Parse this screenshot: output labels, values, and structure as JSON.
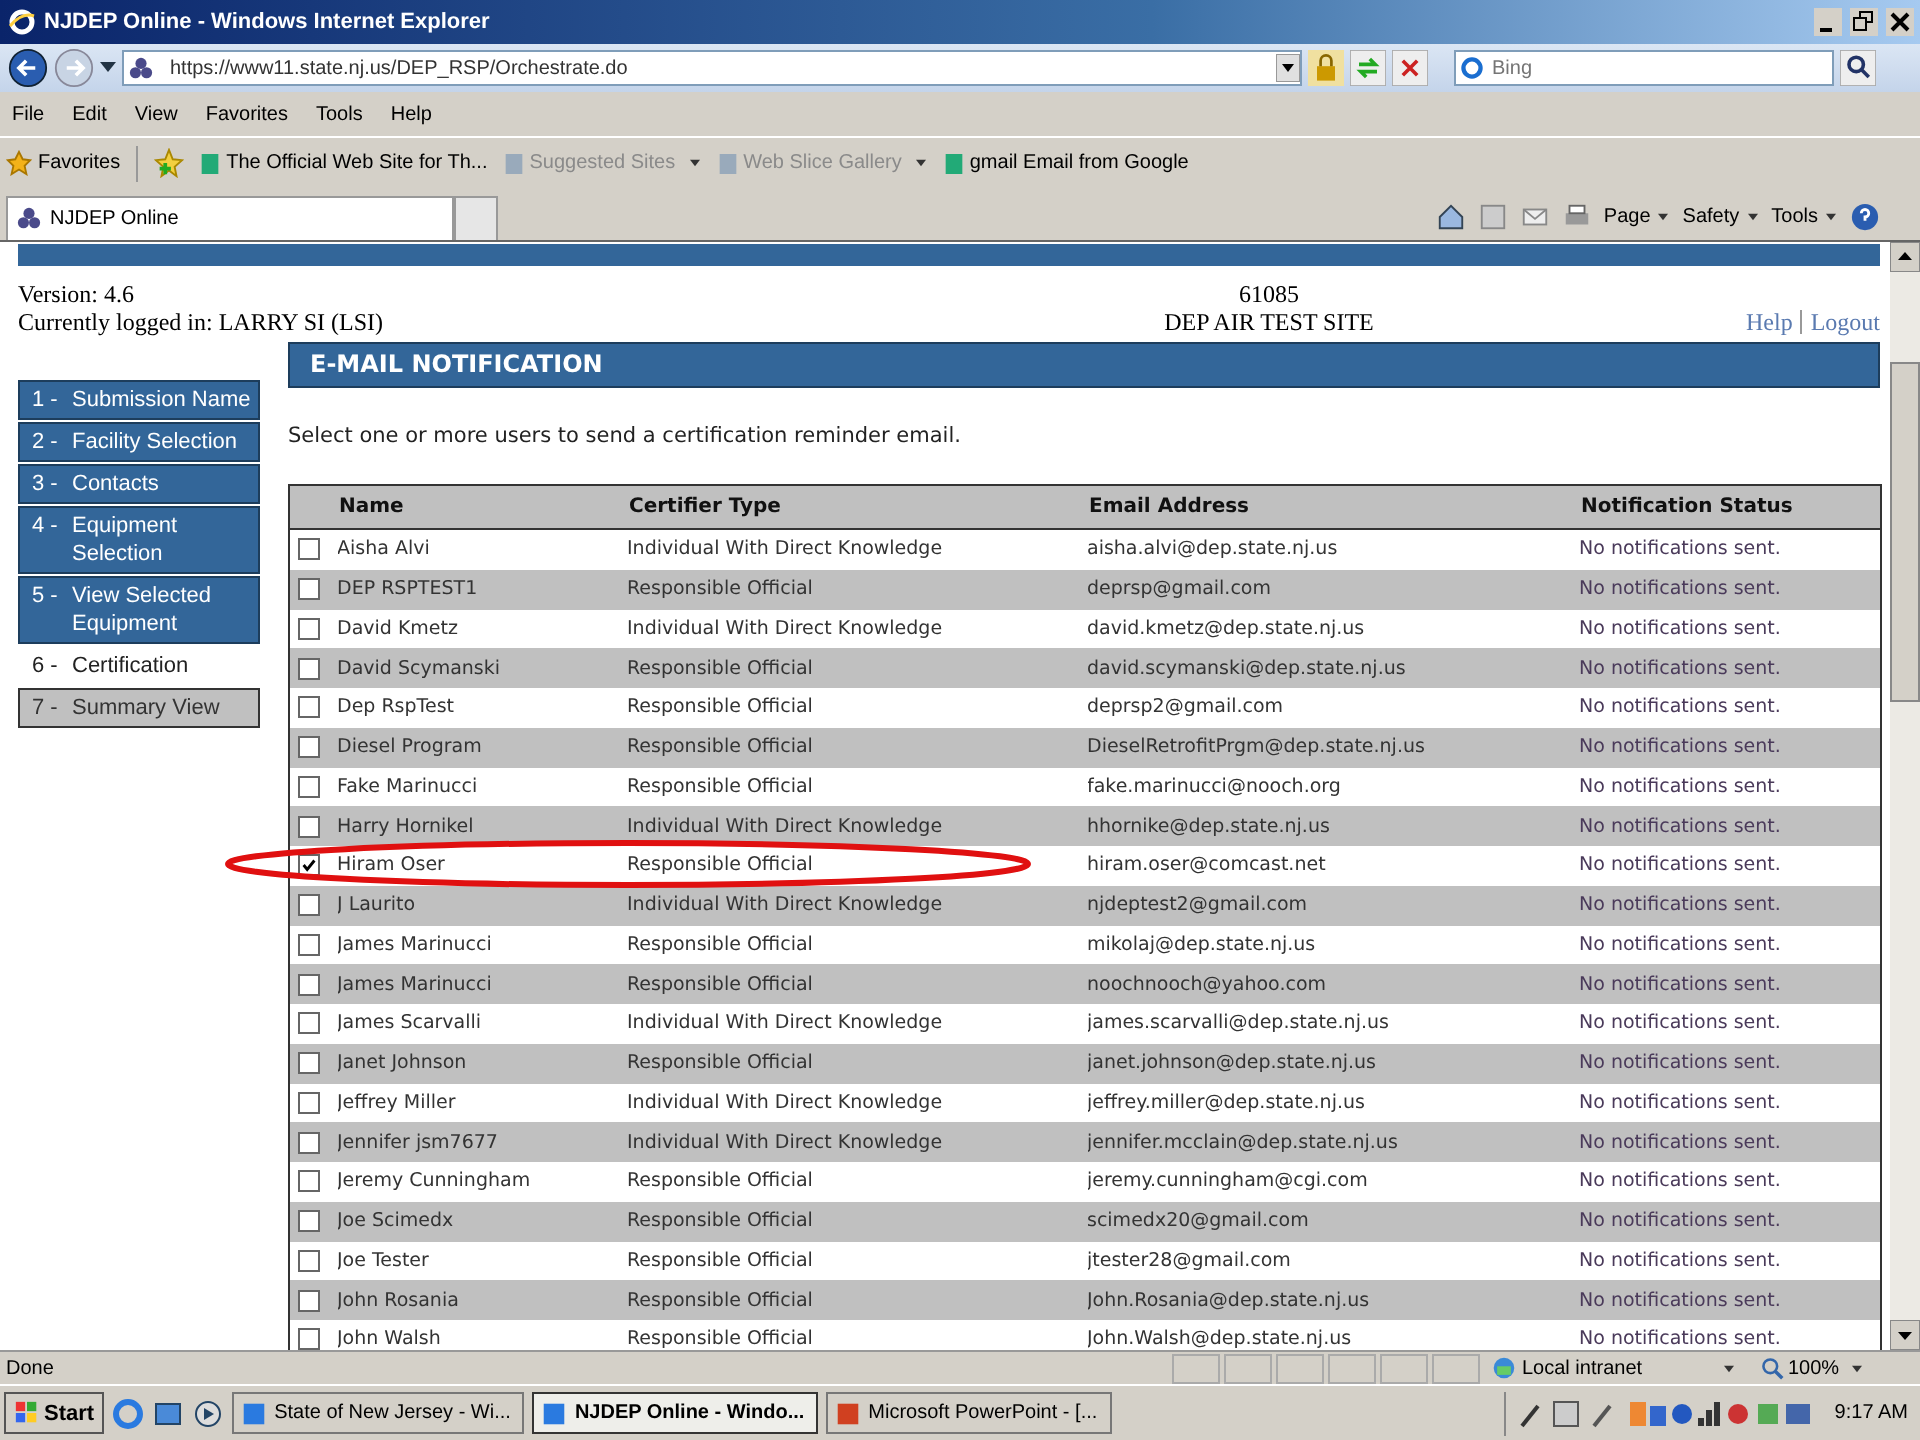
{
  "window": {
    "title": "NJDEP Online - Windows Internet Explorer"
  },
  "address_bar": {
    "url": "https://www11.state.nj.us/DEP_RSP/Orchestrate.do",
    "search_placeholder": "Bing"
  },
  "menu": [
    "File",
    "Edit",
    "View",
    "Favorites",
    "Tools",
    "Help"
  ],
  "favorites_bar": {
    "label": "Favorites",
    "links": [
      {
        "label": "The Official Web Site for Th...",
        "disabled": false,
        "dropdown": false
      },
      {
        "label": "Suggested Sites",
        "disabled": true,
        "dropdown": true
      },
      {
        "label": "Web Slice Gallery",
        "disabled": true,
        "dropdown": true
      },
      {
        "label": "gmail Email from Google",
        "disabled": false,
        "dropdown": false
      }
    ]
  },
  "tabs": [
    {
      "label": "NJDEP Online",
      "selected": true
    }
  ],
  "command_bar": [
    "Page",
    "Safety",
    "Tools"
  ],
  "page": {
    "version": "Version: 4.6",
    "logged_in": "Currently logged in: LARRY SI (LSI)",
    "site_id": "61085",
    "site_name": "DEP AIR TEST SITE",
    "links": [
      "Help",
      "Logout"
    ]
  },
  "steps": [
    {
      "prefix": "1 -",
      "label": "Submission Name",
      "selected": false,
      "disabled": false
    },
    {
      "prefix": "2 -",
      "label": "Facility Selection",
      "selected": false,
      "disabled": false
    },
    {
      "prefix": "3 -",
      "label": "Contacts",
      "selected": false,
      "disabled": false
    },
    {
      "prefix": "4 -",
      "label": "Equipment Selection",
      "selected": false,
      "disabled": false
    },
    {
      "prefix": "5 -",
      "label": "View Selected Equipment",
      "selected": false,
      "disabled": false
    },
    {
      "prefix": "6 -",
      "label": "Certification",
      "selected": true,
      "disabled": false
    },
    {
      "prefix": "7 -",
      "label": "Summary View",
      "selected": false,
      "disabled": true
    }
  ],
  "panel": {
    "title": "E-MAIL NOTIFICATION",
    "instruction": "Select one or more users to send a certification reminder email."
  },
  "table": {
    "columns": [
      "Name",
      "Certifier Type",
      "Email Address",
      "Notification Status"
    ],
    "rows": [
      {
        "checked": false,
        "name": "Aisha Alvi",
        "type": "Individual With Direct Knowledge",
        "email": "aisha.alvi@dep.state.nj.us",
        "status": "No notifications sent."
      },
      {
        "checked": false,
        "name": "DEP RSPTEST1",
        "type": "Responsible Official",
        "email": "deprsp@gmail.com",
        "status": "No notifications sent."
      },
      {
        "checked": false,
        "name": "David Kmetz",
        "type": "Individual With Direct Knowledge",
        "email": "david.kmetz@dep.state.nj.us",
        "status": "No notifications sent."
      },
      {
        "checked": false,
        "name": "David Scymanski",
        "type": "Responsible Official",
        "email": "david.scymanski@dep.state.nj.us",
        "status": "No notifications sent."
      },
      {
        "checked": false,
        "name": "Dep RspTest",
        "type": "Responsible Official",
        "email": "deprsp2@gmail.com",
        "status": "No notifications sent."
      },
      {
        "checked": false,
        "name": "Diesel Program",
        "type": "Responsible Official",
        "email": "DieselRetrofitPrgm@dep.state.nj.us",
        "status": "No notifications sent."
      },
      {
        "checked": false,
        "name": "Fake Marinucci",
        "type": "Responsible Official",
        "email": "fake.marinucci@nooch.org",
        "status": "No notifications sent."
      },
      {
        "checked": false,
        "name": "Harry Hornikel",
        "type": "Individual With Direct Knowledge",
        "email": "hhornike@dep.state.nj.us",
        "status": "No notifications sent."
      },
      {
        "checked": true,
        "name": "Hiram Oser",
        "type": "Responsible Official",
        "email": "hiram.oser@comcast.net",
        "status": "No notifications sent."
      },
      {
        "checked": false,
        "name": "J Laurito",
        "type": "Individual With Direct Knowledge",
        "email": "njdeptest2@gmail.com",
        "status": "No notifications sent."
      },
      {
        "checked": false,
        "name": "James Marinucci",
        "type": "Responsible Official",
        "email": "mikolaj@dep.state.nj.us",
        "status": "No notifications sent."
      },
      {
        "checked": false,
        "name": "James Marinucci",
        "type": "Responsible Official",
        "email": "noochnooch@yahoo.com",
        "status": "No notifications sent."
      },
      {
        "checked": false,
        "name": "James Scarvalli",
        "type": "Individual With Direct Knowledge",
        "email": "james.scarvalli@dep.state.nj.us",
        "status": "No notifications sent."
      },
      {
        "checked": false,
        "name": "Janet Johnson",
        "type": "Responsible Official",
        "email": "janet.johnson@dep.state.nj.us",
        "status": "No notifications sent."
      },
      {
        "checked": false,
        "name": "Jeffrey Miller",
        "type": "Individual With Direct Knowledge",
        "email": "jeffrey.miller@dep.state.nj.us",
        "status": "No notifications sent."
      },
      {
        "checked": false,
        "name": "Jennifer jsm7677",
        "type": "Individual With Direct Knowledge",
        "email": "jennifer.mcclain@dep.state.nj.us",
        "status": "No notifications sent."
      },
      {
        "checked": false,
        "name": "Jeremy Cunningham",
        "type": "Responsible Official",
        "email": "jeremy.cunningham@cgi.com",
        "status": "No notifications sent."
      },
      {
        "checked": false,
        "name": "Joe Scimedx",
        "type": "Responsible Official",
        "email": "scimedx20@gmail.com",
        "status": "No notifications sent."
      },
      {
        "checked": false,
        "name": "Joe Tester",
        "type": "Responsible Official",
        "email": "jtester28@gmail.com",
        "status": "No notifications sent."
      },
      {
        "checked": false,
        "name": "John Rosania",
        "type": "Responsible Official",
        "email": "John.Rosania@dep.state.nj.us",
        "status": "No notifications sent."
      },
      {
        "checked": false,
        "name": "John Walsh",
        "type": "Responsible Official",
        "email": "John.Walsh@dep.state.nj.us",
        "status": "No notifications sent."
      }
    ]
  },
  "status_bar": {
    "text": "Done",
    "zone": "Local intranet",
    "zoom": "100%"
  },
  "taskbar": {
    "start": "Start",
    "tasks": [
      {
        "label": "State of New Jersey - Wi...",
        "selected": false
      },
      {
        "label": "NJDEP Online - Windo...",
        "selected": true
      },
      {
        "label": "Microsoft PowerPoint - [...",
        "selected": false
      }
    ],
    "clock": "9:17 AM"
  }
}
